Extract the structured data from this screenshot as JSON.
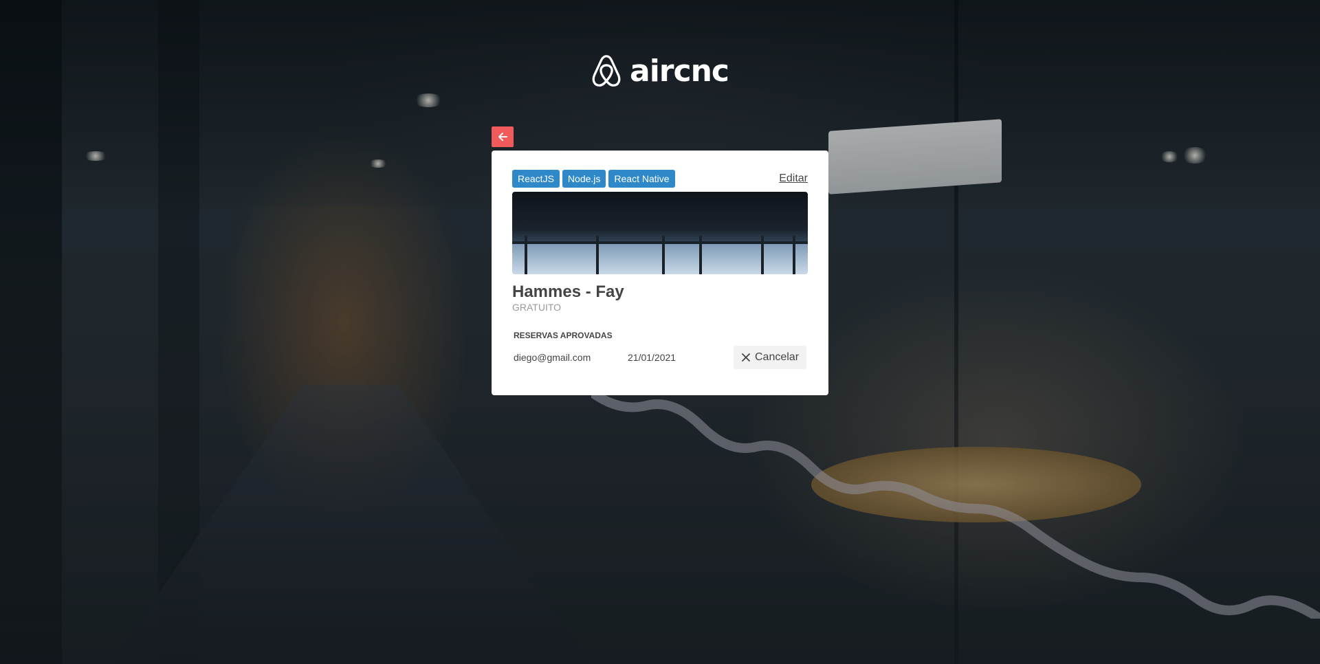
{
  "app": {
    "logo_text": "aircnc"
  },
  "spot": {
    "techs": [
      "ReactJS",
      "Node.js",
      "React Native"
    ],
    "edit_label": "Editar",
    "company": "Hammes - Fay",
    "price": "GRATUITO"
  },
  "bookings": {
    "section_title": "RESERVAS APROVADAS",
    "items": [
      {
        "user_email": "diego@gmail.com",
        "date": "21/01/2021",
        "cancel_label": "Cancelar"
      }
    ]
  },
  "colors": {
    "accent": "#f05a5b",
    "tech_badge": "#2f89c9",
    "text": "#444444",
    "muted": "#999999"
  },
  "icons": {
    "back": "arrow-left-icon",
    "cancel": "close-icon",
    "logo": "airbnb-belo-icon"
  }
}
